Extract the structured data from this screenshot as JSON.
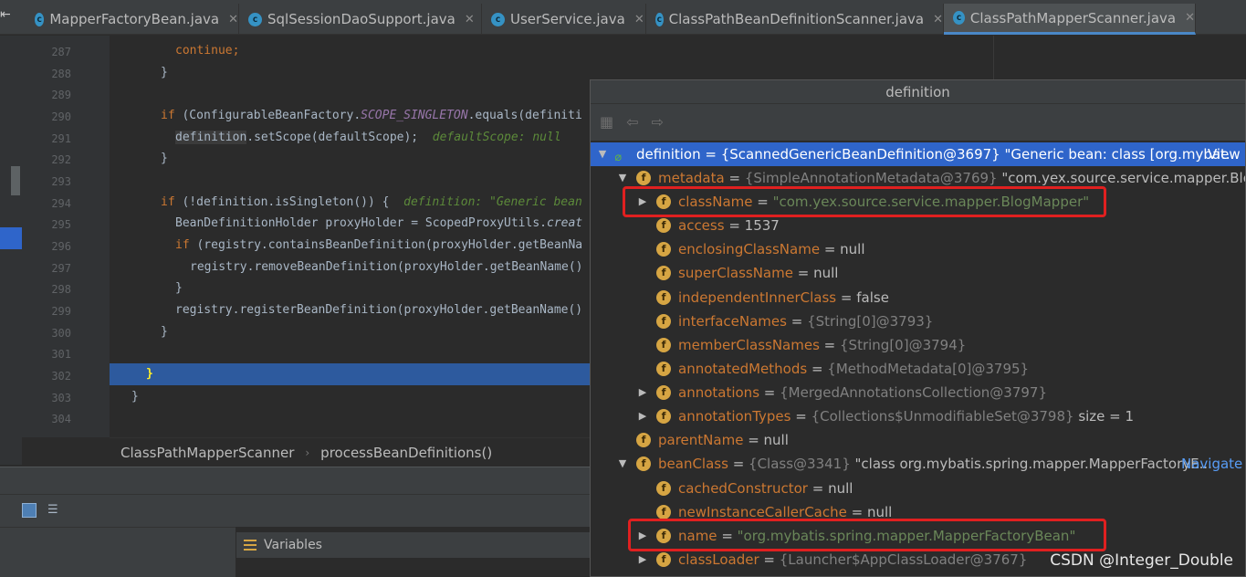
{
  "tabs": [
    {
      "label": "MapperFactoryBean.java",
      "icon": "class-icon",
      "active": false
    },
    {
      "label": "SqlSessionDaoSupport.java",
      "icon": "class-icon",
      "active": false
    },
    {
      "label": "UserService.java",
      "icon": "class-icon",
      "active": false
    },
    {
      "label": "ClassPathBeanDefinitionScanner.java",
      "icon": "class-icon",
      "active": false
    },
    {
      "label": "ClassPathMapperScanner.java",
      "icon": "class-icon",
      "active": true
    }
  ],
  "editor": {
    "line_numbers": [
      "287",
      "288",
      "289",
      "290",
      "291",
      "292",
      "293",
      "294",
      "295",
      "296",
      "297",
      "298",
      "299",
      "300",
      "301",
      "302",
      "303",
      "304"
    ],
    "lines": {
      "l287": "continue;",
      "l288": "}",
      "l290a": "if",
      "l290b": " (ConfigurableBeanFactory.",
      "l290c": "SCOPE_SINGLETON",
      "l290d": ".equals(definiti",
      "l291a": "definition",
      "l291b": ".setScope(defaultScope);",
      "l291c": "defaultScope: null",
      "l292": "}",
      "l294a": "if",
      "l294b": " (!definition.isSingleton()) {",
      "l294c": "definition: \"Generic bean",
      "l295a": "BeanDefinitionHolder proxyHolder = ScopedProxyUtils.",
      "l295b": "creat",
      "l296a": "if",
      "l296b": " (registry.containsBeanDefinition(proxyHolder.getBeanNa",
      "l297": "registry.removeBeanDefinition(proxyHolder.getBeanName()",
      "l298": "}",
      "l299": "registry.registerBeanDefinition(proxyHolder.getBeanName()",
      "l300": "}",
      "l302": "}",
      "l303": "}"
    }
  },
  "breadcrumb": {
    "class": "ClassPathMapperScanner",
    "method": "processBeanDefinitions()"
  },
  "variables_tab": {
    "label": "Variables"
  },
  "popup": {
    "title": "definition",
    "rows": [
      {
        "name": "definition",
        "eq": " = ",
        "ref": "{ScannedGenericBeanDefinition@3697}",
        "val": " \"Generic bean: class [org.mybat...",
        "nav": "View"
      },
      {
        "name": "metadata",
        "eq": " = ",
        "ref": "{SimpleAnnotationMetadata@3769}",
        "val": " \"com.yex.source.service.mapper.BlogM"
      },
      {
        "name": "className",
        "eq": " = ",
        "str": "\"com.yex.source.service.mapper.BlogMapper\""
      },
      {
        "name": "access",
        "eq": " = ",
        "val": "1537"
      },
      {
        "name": "enclosingClassName",
        "eq": " = ",
        "val": "null"
      },
      {
        "name": "superClassName",
        "eq": " = ",
        "val": "null"
      },
      {
        "name": "independentInnerClass",
        "eq": " = ",
        "val": "false"
      },
      {
        "name": "interfaceNames",
        "eq": " = ",
        "ref": "{String[0]@3793}"
      },
      {
        "name": "memberClassNames",
        "eq": " = ",
        "ref": "{String[0]@3794}"
      },
      {
        "name": "annotatedMethods",
        "eq": " = ",
        "ref": "{MethodMetadata[0]@3795}"
      },
      {
        "name": "annotations",
        "eq": " = ",
        "ref": "{MergedAnnotationsCollection@3797}"
      },
      {
        "name": "annotationTypes",
        "eq": " = ",
        "ref": "{Collections$UnmodifiableSet@3798}",
        "val": " size = 1"
      },
      {
        "name": "parentName",
        "eq": " = ",
        "val": "null"
      },
      {
        "name": "beanClass",
        "eq": " = ",
        "ref": "{Class@3341}",
        "val": " \"class org.mybatis.spring.mapper.MapperFactoryE...",
        "nav": "Navigate"
      },
      {
        "name": "cachedConstructor",
        "eq": " = ",
        "val": "null"
      },
      {
        "name": "newInstanceCallerCache",
        "eq": " = ",
        "val": "null"
      },
      {
        "name": "name",
        "eq": " = ",
        "str": "\"org.mybatis.spring.mapper.MapperFactoryBean\""
      },
      {
        "name": "classLoader",
        "eq": " = ",
        "ref": "{Launcher$AppClassLoader@3767}"
      }
    ]
  },
  "watermark": "CSDN @Integer_Double",
  "colors": {
    "accent": "#2f65ca",
    "highlight_box": "#e02020",
    "field_icon": "#d6a543"
  }
}
